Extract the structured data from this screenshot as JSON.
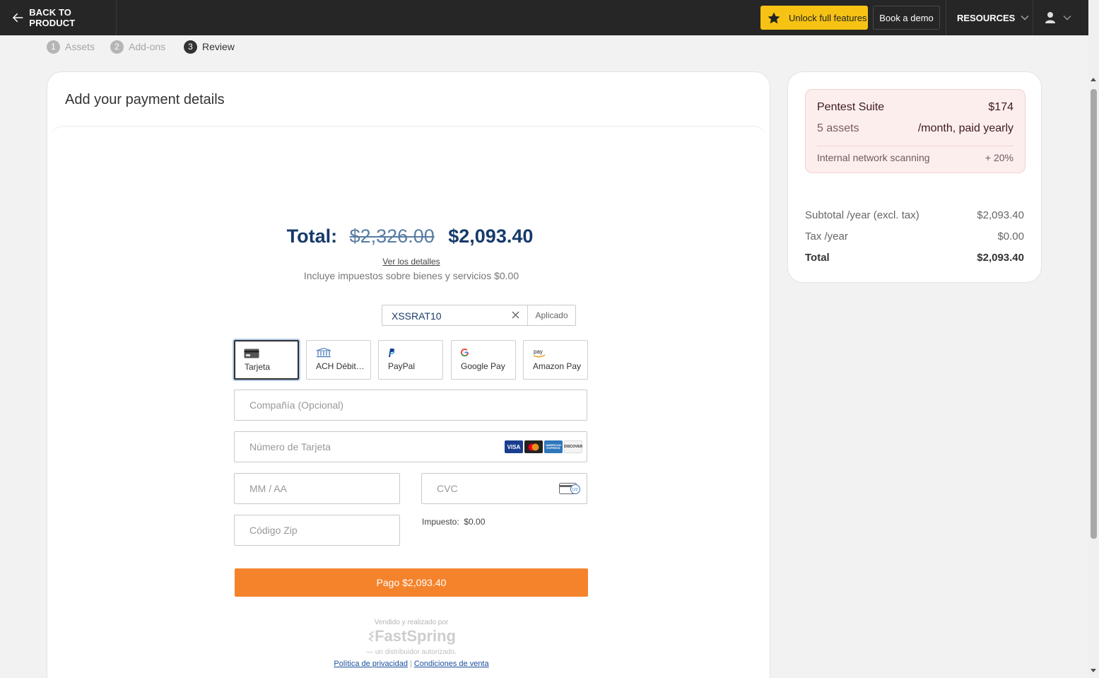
{
  "topbar": {
    "back_label": "BACK TO PRODUCT",
    "unlock_label": "Unlock full features",
    "demo_label": "Book a demo",
    "resources_label": "RESOURCES"
  },
  "steps": [
    {
      "num": "1",
      "label": "Assets"
    },
    {
      "num": "2",
      "label": "Add-ons"
    },
    {
      "num": "3",
      "label": "Review"
    }
  ],
  "payment": {
    "title": "Add your payment details",
    "total_label": "Total:",
    "original_price": "$2,326.00",
    "discounted_price": "$2,093.40",
    "details_link": "Ver los detalles",
    "tax_note": "Incluye impuestos sobre bienes y servicios $0.00",
    "coupon_code": "XSSRAT10",
    "coupon_status": "Aplicado",
    "methods": [
      "Tarjeta",
      "ACH Débit…",
      "PayPal",
      "Google Pay",
      "Amazon Pay"
    ],
    "company_placeholder": "Compañía (Opcional)",
    "card_number_placeholder": "Número de Tarjeta",
    "expiry_placeholder": "MM / AA",
    "cvc_placeholder": "CVC",
    "zip_placeholder": "Código Zip",
    "tax_label": "Impuesto:",
    "tax_value": "$0.00",
    "pay_button": "Pago $2,093.40",
    "sold_by": "Vendido y realizado por",
    "distributor_logo": "FastSpring",
    "distributor_note": "— un distribuidor autorizado.",
    "privacy_link": "Política de privacidad",
    "terms_link": "Condiciones de venta",
    "card_brands": [
      "VISA",
      "",
      "AMERICAN EXPRESS",
      "DISCOVER"
    ]
  },
  "summary": {
    "product_name": "Pentest Suite",
    "product_price": "$174",
    "assets": "5 assets",
    "billing": "/month, paid yearly",
    "addon_name": "Internal network scanning",
    "addon_value": "+ 20%",
    "subtotal_label": "Subtotal /year (excl. tax)",
    "subtotal_value": "$2,093.40",
    "tax_label": "Tax /year",
    "tax_value": "$0.00",
    "total_label": "Total",
    "total_value": "$2,093.40"
  },
  "colors": {
    "accent_yellow": "#f6c314",
    "pay_orange": "#f5832b",
    "price_navy": "#163a6a"
  }
}
